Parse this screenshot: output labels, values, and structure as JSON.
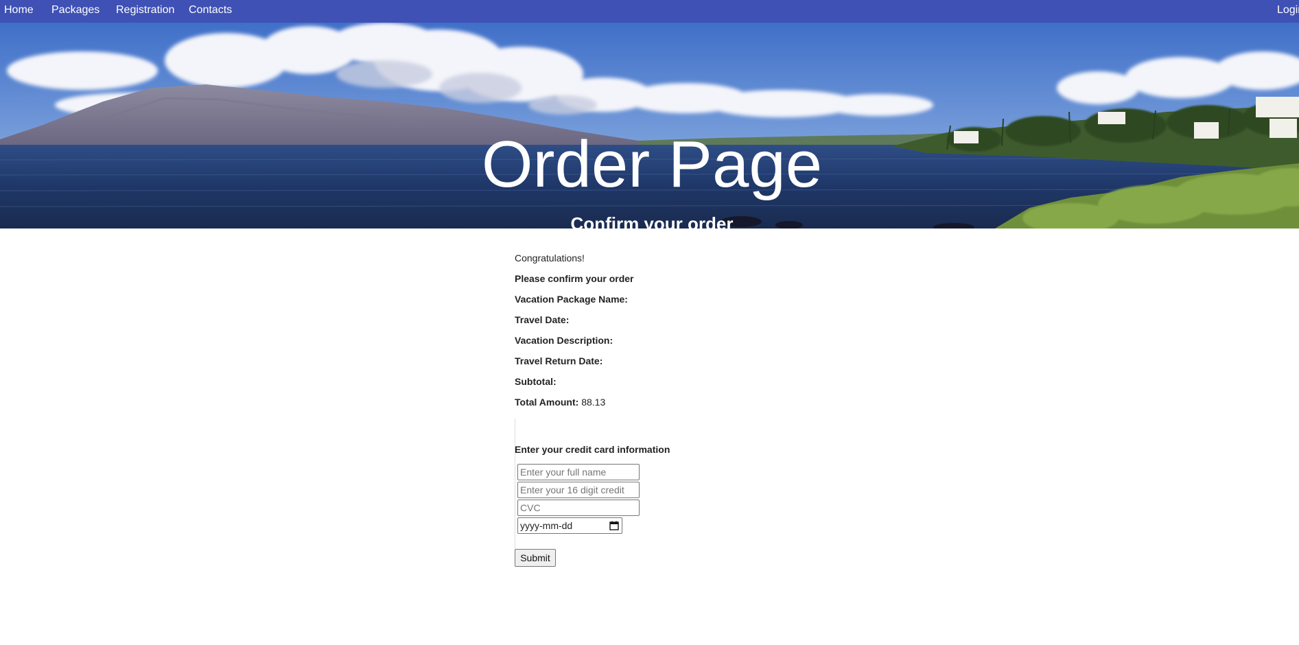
{
  "nav": {
    "home": "Home",
    "packages": "Packages",
    "registration": "Registration",
    "contacts": "Contacts",
    "login": "Login"
  },
  "hero": {
    "title": "Order Page",
    "subtitle": "Confirm your order"
  },
  "order": {
    "congrats": "Congratulations!",
    "confirm_heading": "Please confirm your order",
    "package_name_label": "Vacation Package Name:",
    "package_name_value": "",
    "travel_date_label": "Travel Date:",
    "travel_date_value": "",
    "description_label": "Vacation Description:",
    "description_value": "",
    "return_date_label": "Travel Return Date:",
    "return_date_value": "",
    "subtotal_label": "Subtotal:",
    "subtotal_value": "",
    "total_label": "Total Amount:",
    "total_value": "88.13"
  },
  "payment": {
    "heading": "Enter your credit card information",
    "name_placeholder": "Enter your full name",
    "card_placeholder": "Enter your 16 digit credit",
    "cvc_placeholder": "CVC",
    "date_placeholder": "yyyy-mm-dd",
    "submit_label": "Submit"
  },
  "icons": {
    "calendar": "calendar-icon"
  },
  "colors": {
    "navbar": "#3f51b5",
    "nav_text": "#ffffff",
    "hero_text": "#ffffff"
  }
}
